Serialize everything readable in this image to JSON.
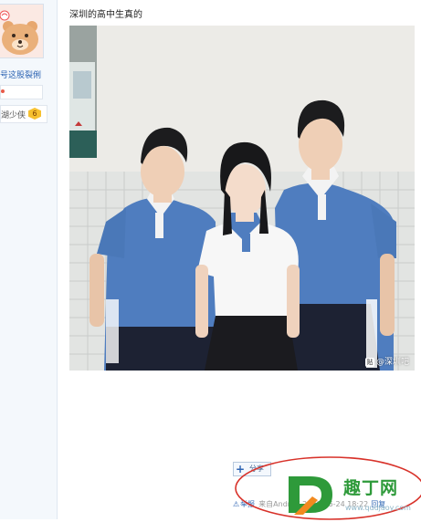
{
  "post": {
    "title": "深圳的高中生真的",
    "watermark_text": "@深圳吧",
    "watermark_icon": "贴"
  },
  "sidebar": {
    "username": "号这股裂俐",
    "badge_text": "湖少侠",
    "badge_level": "6"
  },
  "actions": {
    "share_label": "分享",
    "report_label": "举报",
    "footer_meta": "来自Andr       帖    2020-06-24 18:22",
    "reply_label": "回复"
  },
  "overlay": {
    "brand_text": "趣丁网",
    "brand_url": "www.qudjaoy.com"
  },
  "colors": {
    "link": "#2d64b3",
    "annotation_circle": "#d8322a",
    "brand_green": "#2e9a3a"
  }
}
